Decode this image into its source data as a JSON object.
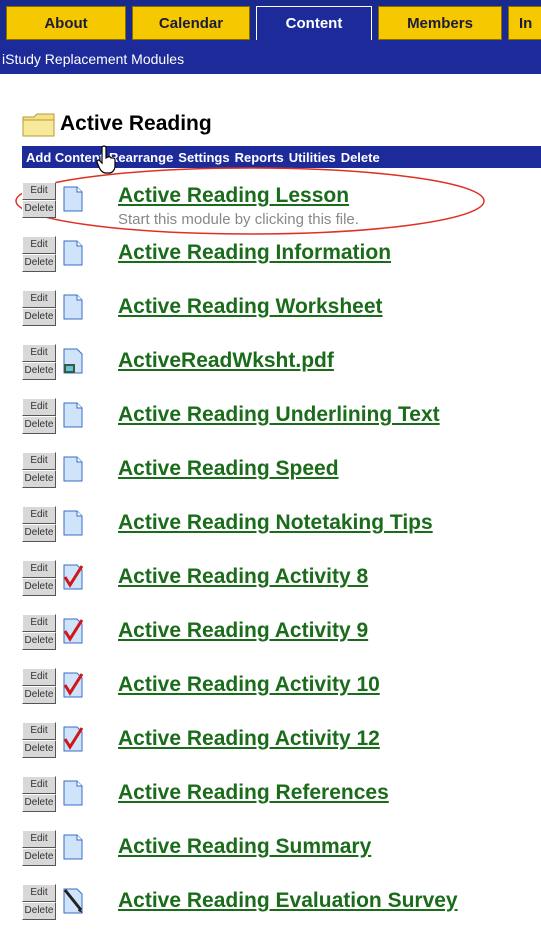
{
  "tabs": [
    {
      "label": "About",
      "active": false
    },
    {
      "label": "Calendar",
      "active": false
    },
    {
      "label": "Content",
      "active": true
    },
    {
      "label": "Members",
      "active": false
    },
    {
      "label": "In",
      "active": false
    }
  ],
  "subbar": {
    "title": "iStudy Replacement Modules"
  },
  "folder": {
    "title": "Active Reading",
    "icon": "folder-icon"
  },
  "actions": [
    "Add Content",
    "Rearrange",
    "Settings",
    "Reports",
    "Utilities",
    "Delete"
  ],
  "buttons": {
    "edit": "Edit",
    "delete": "Delete"
  },
  "items": [
    {
      "title": "Active Reading Lesson",
      "desc": "Start this module by clicking this file.",
      "icon": "document-icon"
    },
    {
      "title": "Active Reading Information",
      "icon": "document-icon"
    },
    {
      "title": "Active Reading Worksheet",
      "icon": "document-icon"
    },
    {
      "title": "ActiveReadWksht.pdf",
      "icon": "file-icon"
    },
    {
      "title": "Active Reading Underlining Text",
      "icon": "document-icon"
    },
    {
      "title": "Active Reading Speed",
      "icon": "document-icon"
    },
    {
      "title": "Active Reading Notetaking Tips",
      "icon": "document-icon"
    },
    {
      "title": "Active Reading Activity 8",
      "icon": "assignment-check-icon"
    },
    {
      "title": "Active Reading Activity 9",
      "icon": "assignment-check-icon"
    },
    {
      "title": "Active Reading Activity 10",
      "icon": "assignment-check-icon"
    },
    {
      "title": "Active Reading Activity 12",
      "icon": "assignment-check-icon"
    },
    {
      "title": "Active Reading References",
      "icon": "document-icon"
    },
    {
      "title": "Active Reading Summary",
      "icon": "document-icon"
    },
    {
      "title": "Active Reading Evaluation Survey",
      "icon": "survey-pencil-icon"
    }
  ],
  "colors": {
    "nav": "#1d2a9a",
    "tab": "#f5c800",
    "link": "#1a6b1a",
    "highlight": "#e03020"
  }
}
